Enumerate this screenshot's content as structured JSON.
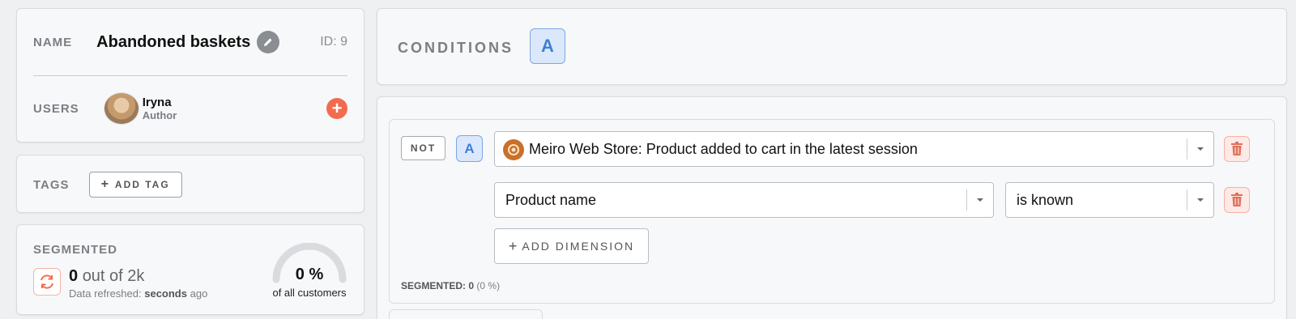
{
  "segment": {
    "name_label": "NAME",
    "name": "Abandoned baskets",
    "id_text": "ID: 9",
    "users_label": "USERS",
    "user": {
      "name": "Iryna",
      "role": "Author"
    },
    "tags_label": "TAGS",
    "add_tag_label": "ADD TAG"
  },
  "segmented": {
    "label": "SEGMENTED",
    "count": "0",
    "out_of": "out of 2k",
    "refreshed_prefix": "Data refreshed:",
    "refreshed_value": "seconds",
    "refreshed_suffix": "ago",
    "percent": "0 %",
    "percent_fraction": 0,
    "percent_caption": "of all customers"
  },
  "conditions": {
    "title": "CONDITIONS",
    "badge": "A",
    "row": {
      "not_label": "NOT",
      "badge": "A",
      "source": "Meiro Web Store: Product added to cart in the latest session",
      "dimension": "Product name",
      "operator": "is known",
      "add_dimension_label": "ADD DIMENSION",
      "segmented_label": "SEGMENTED:",
      "segmented_count": "0",
      "segmented_pct": "(0 %)"
    }
  },
  "colors": {
    "accent_blue": "#3f7fd6",
    "danger": "#f36b4f",
    "store_brand": "#c9702a"
  },
  "icons": [
    "pencil-icon",
    "plus-icon",
    "refresh-icon",
    "chevron-down-icon",
    "trash-icon",
    "store-logo-icon"
  ]
}
